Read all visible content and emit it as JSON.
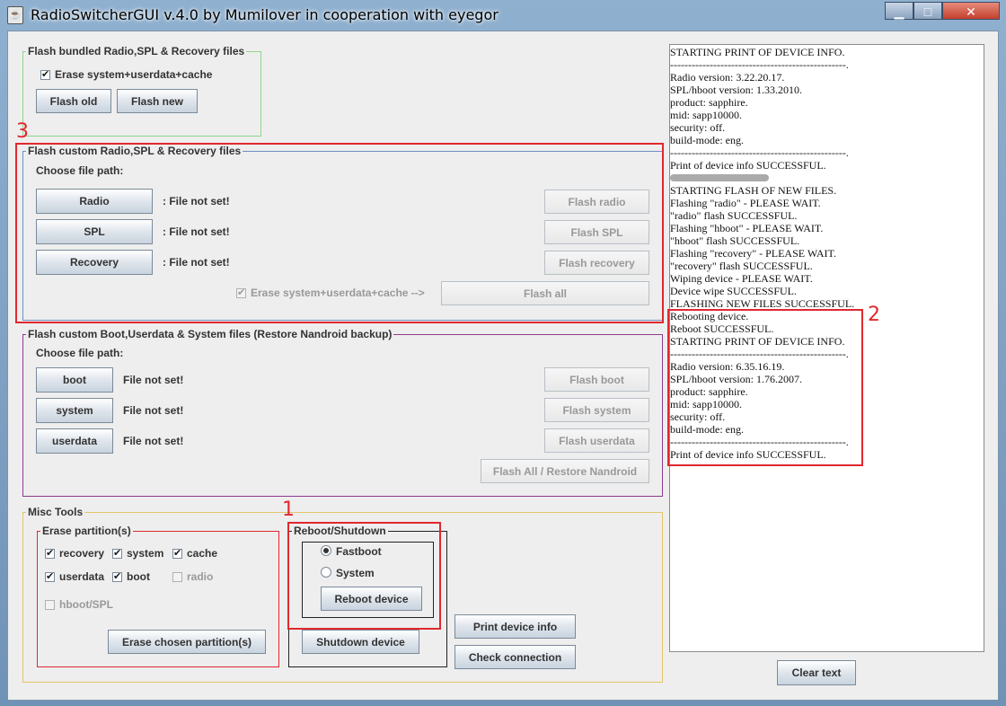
{
  "window": {
    "title": "RadioSwitcherGUI v.4.0 by Mumilover in cooperation with eyegor",
    "controls": {
      "minimize": "▁",
      "maximize": "□",
      "close": "✕"
    }
  },
  "bundled": {
    "legend": "Flash bundled Radio,SPL & Recovery files",
    "erase_label": "Erase system+userdata+cache",
    "flash_old": "Flash old",
    "flash_new": "Flash new"
  },
  "custom": {
    "legend": "Flash custom Radio,SPL & Recovery files",
    "choose_label": "Choose file path:",
    "rows": [
      {
        "button": "Radio",
        "status": ": File not set!",
        "flash": "Flash radio"
      },
      {
        "button": "SPL",
        "status": ": File not set!",
        "flash": "Flash SPL"
      },
      {
        "button": "Recovery",
        "status": ": File not set!",
        "flash": "Flash recovery"
      }
    ],
    "erase_label": "Erase system+userdata+cache  -->",
    "flash_all": "Flash all"
  },
  "nandroid": {
    "legend": "Flash custom Boot,Userdata & System files (Restore Nandroid backup)",
    "choose_label": "Choose file path:",
    "rows": [
      {
        "button": "boot",
        "status": "File not set!",
        "flash": "Flash boot"
      },
      {
        "button": "system",
        "status": "File not set!",
        "flash": "Flash system"
      },
      {
        "button": "userdata",
        "status": "File not set!",
        "flash": "Flash userdata"
      }
    ],
    "flash_all": "Flash All / Restore Nandroid"
  },
  "misc": {
    "legend": "Misc Tools",
    "erase_legend": "Erase partition(s)",
    "partitions": {
      "recovery": "recovery",
      "system": "system",
      "cache": "cache",
      "userdata": "userdata",
      "boot": "boot",
      "radio": "radio",
      "hboot": "hboot/SPL"
    },
    "erase_button": "Erase chosen partition(s)",
    "reboot_legend": "Reboot/Shutdown",
    "fastboot": "Fastboot",
    "system_opt": "System",
    "reboot_button": "Reboot device",
    "shutdown_button": "Shutdown device",
    "print_info": "Print device info",
    "check_connection": "Check connection"
  },
  "log": [
    "STARTING PRINT OF DEVICE INFO.",
    "-------------------------------------------------.",
    "Radio version: 3.22.20.17.",
    "SPL/hboot version: 1.33.2010.",
    "product: sapphire.",
    "mid: sapp10000.",
    "security: off.",
    "build-mode: eng.",
    "-------------------------------------------------.",
    "Print of device info SUCCESSFUL.",
    "",
    "STARTING FLASH OF NEW FILES.",
    "Flashing \"radio\" - PLEASE WAIT.",
    "\"radio\" flash SUCCESSFUL.",
    "Flashing \"hboot\" - PLEASE WAIT.",
    "\"hboot\" flash SUCCESSFUL.",
    "Flashing \"recovery\" - PLEASE WAIT.",
    "\"recovery\" flash SUCCESSFUL.",
    "Wiping device - PLEASE WAIT.",
    "Device wipe SUCCESSFUL.",
    "FLASHING NEW FILES SUCCESSFUL.",
    "Rebooting device.",
    "Reboot SUCCESSFUL.",
    "STARTING PRINT OF DEVICE INFO.",
    "-------------------------------------------------.",
    "Radio version: 6.35.16.19.",
    "SPL/hboot version: 1.76.2007.",
    "product: sapphire.",
    "mid: sapp10000.",
    "security: off.",
    "build-mode: eng.",
    "-------------------------------------------------.",
    "Print of device info SUCCESSFUL."
  ],
  "clear_text": "Clear text",
  "annotations": {
    "one": "1",
    "two": "2",
    "three": "3"
  },
  "colors": {
    "annotation": "#e0282e",
    "bundled_border": "#8fd68f",
    "custom_border": "#6f8fc4",
    "nandroid_border": "#8e3b8e",
    "misc_border": "#e2c56a"
  }
}
